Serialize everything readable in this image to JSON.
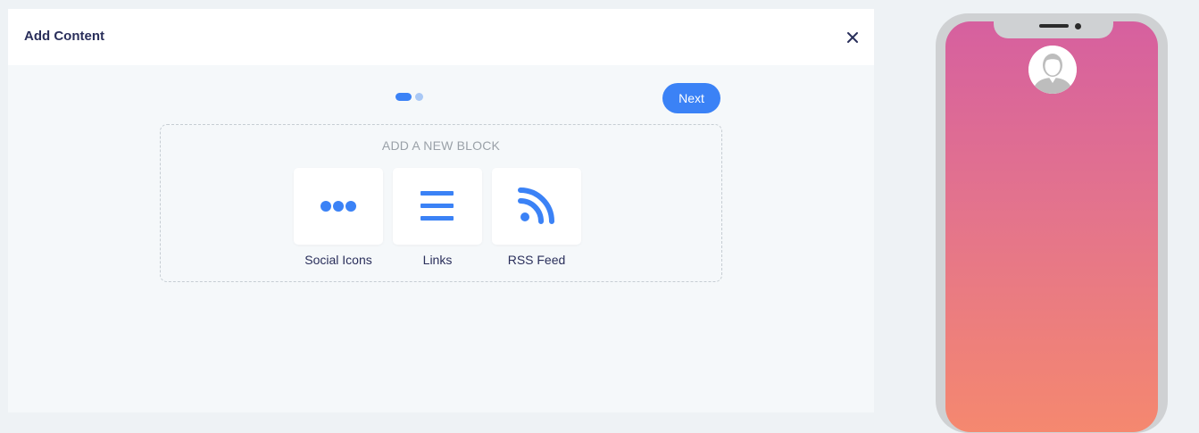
{
  "panel": {
    "title": "Add Content",
    "close_icon": "close-icon",
    "pager": {
      "pages": 2,
      "current": 1
    },
    "next_label": "Next",
    "block_area": {
      "heading": "ADD A NEW BLOCK",
      "tiles": [
        {
          "label": "Social Icons",
          "icon": "more-dots-icon"
        },
        {
          "label": "Links",
          "icon": "list-lines-icon"
        },
        {
          "label": "RSS Feed",
          "icon": "rss-icon"
        }
      ]
    }
  },
  "preview": {
    "avatar_icon": "user-avatar-icon"
  },
  "colors": {
    "accent": "#3b82f6",
    "title_text": "#2a2f5b",
    "gradient_top": "#d6609f",
    "gradient_bottom": "#f5886f"
  }
}
